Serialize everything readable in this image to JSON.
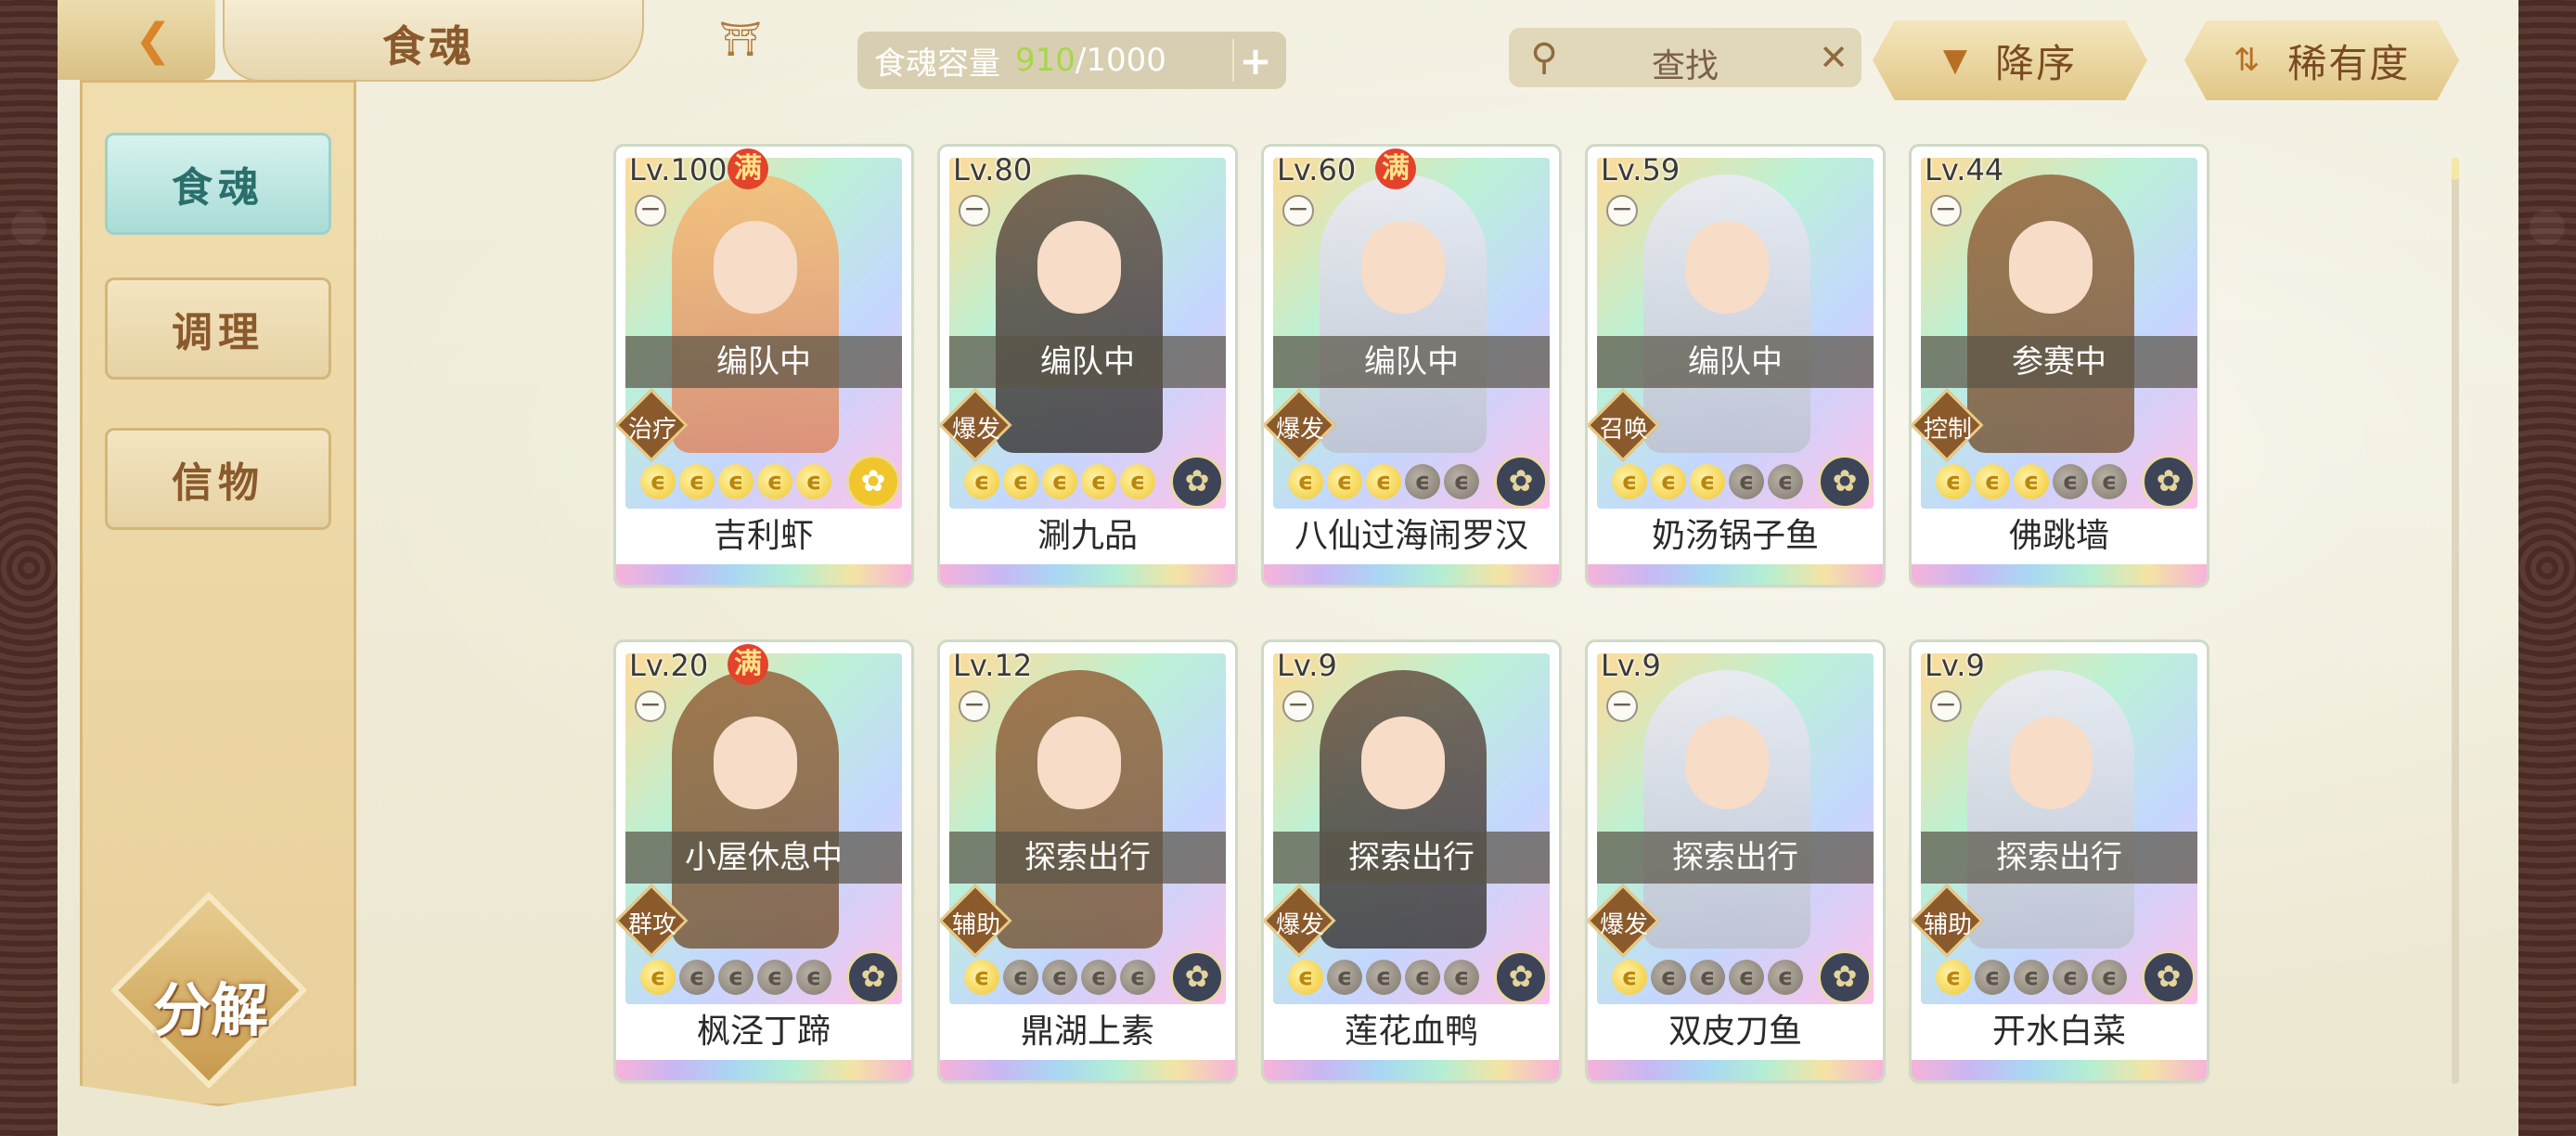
{
  "header": {
    "title": "食魂",
    "capacity_label": "食魂容量",
    "capacity_used": "910",
    "capacity_max": "/1000",
    "search_placeholder": "查找",
    "sort_order_label": "降序",
    "sort_by_label": "稀有度"
  },
  "sidebar": {
    "items": [
      {
        "label": "食魂",
        "active": true
      },
      {
        "label": "调理",
        "active": false
      },
      {
        "label": "信物",
        "active": false
      }
    ],
    "decompose_label": "分解"
  },
  "cards": [
    {
      "level": "Lv.100",
      "max": true,
      "status": "编队中",
      "role": "治疗",
      "stars": 5,
      "name": "吉利虾",
      "element": "gold-flower"
    },
    {
      "level": "Lv.80",
      "max": false,
      "status": "编队中",
      "role": "爆发",
      "stars": 5,
      "name": "涮九品",
      "element": "blue-flower"
    },
    {
      "level": "Lv.60",
      "max": true,
      "status": "编队中",
      "role": "爆发",
      "stars": 3,
      "name": "八仙过海闹罗汉",
      "element": "blue-flower"
    },
    {
      "level": "Lv.59",
      "max": false,
      "status": "编队中",
      "role": "召唤",
      "stars": 3,
      "name": "奶汤锅子鱼",
      "element": "blue-flower"
    },
    {
      "level": "Lv.44",
      "max": false,
      "status": "参赛中",
      "role": "控制",
      "stars": 3,
      "name": "佛跳墙",
      "element": "blue-flower"
    },
    {
      "level": "Lv.20",
      "max": true,
      "status": "小屋休息中",
      "role": "群攻",
      "stars": 1,
      "name": "枫泾丁蹄",
      "element": "blue-flower"
    },
    {
      "level": "Lv.12",
      "max": false,
      "status": "探索出行",
      "role": "辅助",
      "stars": 1,
      "name": "鼎湖上素",
      "element": "blue-flower"
    },
    {
      "level": "Lv.9",
      "max": false,
      "status": "探索出行",
      "role": "爆发",
      "stars": 1,
      "name": "莲花血鸭",
      "element": "blue-flower"
    },
    {
      "level": "Lv.9",
      "max": false,
      "status": "探索出行",
      "role": "爆发",
      "stars": 1,
      "name": "双皮刀鱼",
      "element": "blue-flower"
    },
    {
      "level": "Lv.9",
      "max": false,
      "status": "探索出行",
      "role": "辅助",
      "stars": 1,
      "name": "开水白菜",
      "element": "blue-flower"
    }
  ],
  "max_badge": "满",
  "colors": {
    "accent": "#a7d64a",
    "brand": "#8a5a2c",
    "active_tab": "#a9dcd6"
  }
}
